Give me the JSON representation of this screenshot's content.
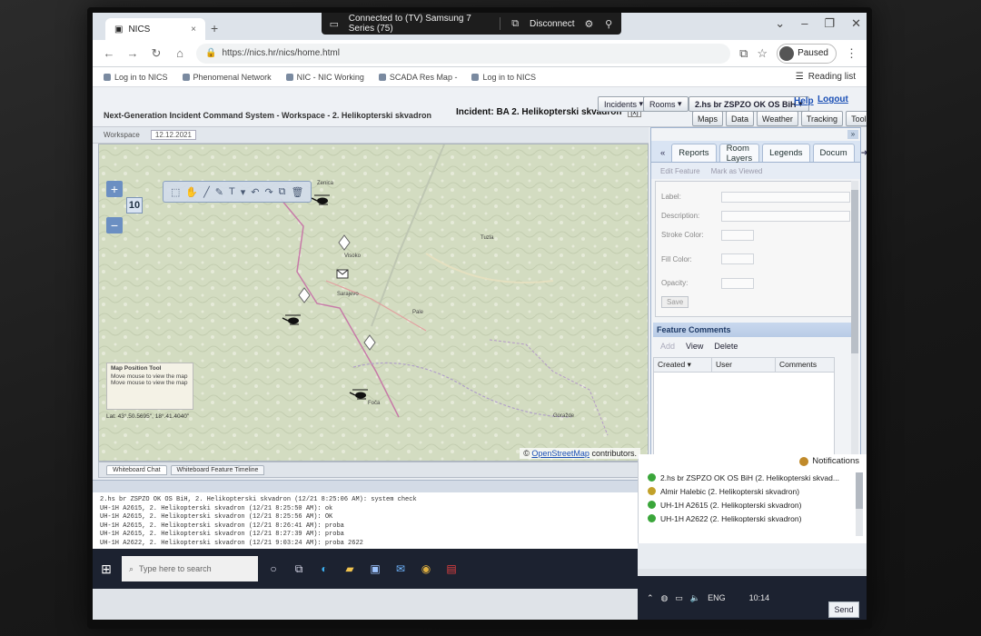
{
  "remote_desktop": {
    "connection_text": "Connected to (TV) Samsung 7 Series (75)",
    "disconnect_label": "Disconnect"
  },
  "browser": {
    "tab_title": "NICS",
    "url": "https://nics.hr/nics/home.html",
    "profile_label": "Paused",
    "reading_list_label": "Reading list",
    "bookmarks": [
      "Log in to NICS",
      "Phenomenal Network",
      "NIC - NIC Working",
      "SCADA Res Map -",
      "Log in to NICS"
    ]
  },
  "app": {
    "title": "Next-Generation Incident Command System - Workspace - 2. Helikopterski skvadron",
    "incident_label": "Incident: BA 2. Helikopterski skvadron",
    "incident_close": "[x]",
    "incidents_button": "Incidents",
    "rooms_button": "Rooms",
    "user_button": "2.hs br ZSPZO OK OS BiH",
    "help_link": "Help",
    "logout_link": "Logout",
    "menu": [
      "Maps",
      "Data",
      "Weather",
      "Tracking",
      "Tools"
    ],
    "subheader": {
      "workspace_label": "Workspace",
      "date": "12.12.2021"
    }
  },
  "map": {
    "zoom_level": "10",
    "zoom_in": "+",
    "zoom_out": "−",
    "hint_title": "Map Position Tool",
    "hint_line1": "Move mouse to view the map",
    "hint_line2": "Move mouse to view the map",
    "coords": "Lat: 43°.50.5695\", 18°.41.4040\"",
    "attribution_prefix": "©",
    "attribution_link": "OpenStreetMap",
    "attribution_suffix": "contributors.",
    "cities": [
      "Sarajevo",
      "Pale",
      "Foča",
      "Goražde",
      "Zenica",
      "Tuzla",
      "Visoko"
    ],
    "tabs": [
      "Whiteboard Chat",
      "Whiteboard Feature Timeline"
    ]
  },
  "right_panel": {
    "tabs": [
      "Reports",
      "Room Layers",
      "Legends",
      "Docum"
    ],
    "tools": [
      "Edit Feature",
      "Mark as Viewed"
    ],
    "form": {
      "label": "Label:",
      "description": "Description:",
      "stroke_color": "Stroke Color:",
      "fill_color": "Fill Color:",
      "opacity": "Opacity:",
      "save": "Save"
    },
    "feature_comments": {
      "title": "Feature Comments",
      "add": "Add",
      "view": "View",
      "delete": "Delete",
      "columns": [
        "Created",
        "User",
        "Comments"
      ]
    }
  },
  "chat": {
    "messages": [
      "2.hs br ZSPZO OK OS BiH, 2. Helikopterski skvadron (12/21 8:25:06 AM): system check",
      "UH-1H A2615, 2. Helikopterski skvadron (12/21 8:25:50 AM): ok",
      "UH-1H A2615, 2. Helikopterski skvadron (12/21 8:25:56 AM): OK",
      "UH-1H A2615, 2. Helikopterski skvadron (12/21 8:26:41 AM): proba",
      "UH-1H A2615, 2. Helikopterski skvadron (12/21 8:27:39 AM): proba",
      "UH-1H A2622, 2. Helikopterski skvadron (12/21 9:03:24 AM): proba 2622"
    ],
    "send_label": "Send"
  },
  "notifications": {
    "title": "Notifications",
    "items": [
      {
        "text": "2.hs br ZSPZO OK OS BiH (2. Helikopterski skvad...",
        "color": "#3aa63a"
      },
      {
        "text": "Almir Halebic (2. Helikopterski skvadron)",
        "color": "#c2a12a"
      },
      {
        "text": "UH-1H A2615 (2. Helikopterski skvadron)",
        "color": "#3aa63a"
      },
      {
        "text": "UH-1H A2622 (2. Helikopterski skvadron)",
        "color": "#3aa63a"
      }
    ]
  },
  "taskbar": {
    "search_placeholder": "Type here to search",
    "language": "ENG",
    "time": "10:14"
  }
}
